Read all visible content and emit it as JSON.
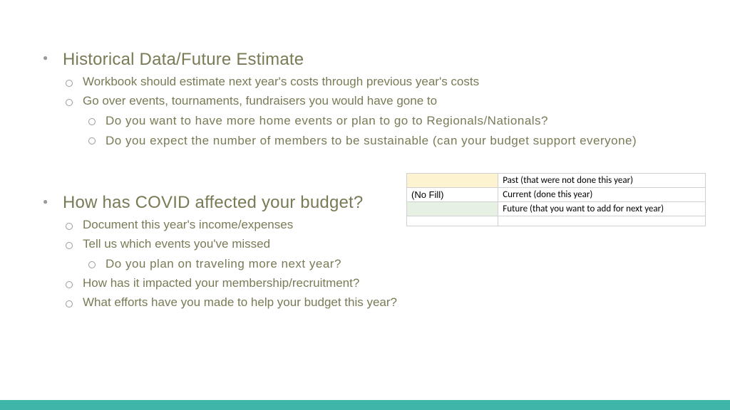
{
  "sections": [
    {
      "heading": "Historical Data/Future Estimate",
      "items": [
        {
          "text": "Workbook should estimate next year's costs through previous year's costs"
        },
        {
          "text": "Go over events, tournaments, fundraisers you would have gone to",
          "sub": [
            "Do you want to have more home events or plan to go to Regionals/Nationals?",
            "Do you expect the number of members to be sustainable (can your budget support everyone)"
          ]
        }
      ]
    },
    {
      "heading": "How has COVID affected your budget?",
      "items": [
        {
          "text": "Document this year's income/expenses"
        },
        {
          "text": "Tell us which events you've missed",
          "sub": [
            "Do you plan on traveling more next year?"
          ]
        },
        {
          "text": "How has it impacted your membership/recruitment?"
        },
        {
          "text": "What efforts have you made to help your budget this year?"
        }
      ]
    }
  ],
  "legend": {
    "rows": [
      {
        "swatch_class": "sw-past",
        "swatch_text": "",
        "label": "Past  (that were not done this year)"
      },
      {
        "swatch_class": "sw-current",
        "swatch_text": "(No Fill)",
        "label": "Current (done this year)"
      },
      {
        "swatch_class": "sw-future",
        "swatch_text": "",
        "label": "Future (that you want to add  for next year)"
      }
    ]
  },
  "colors": {
    "accent": "#3fb5a7",
    "text": "#7a7a56"
  }
}
